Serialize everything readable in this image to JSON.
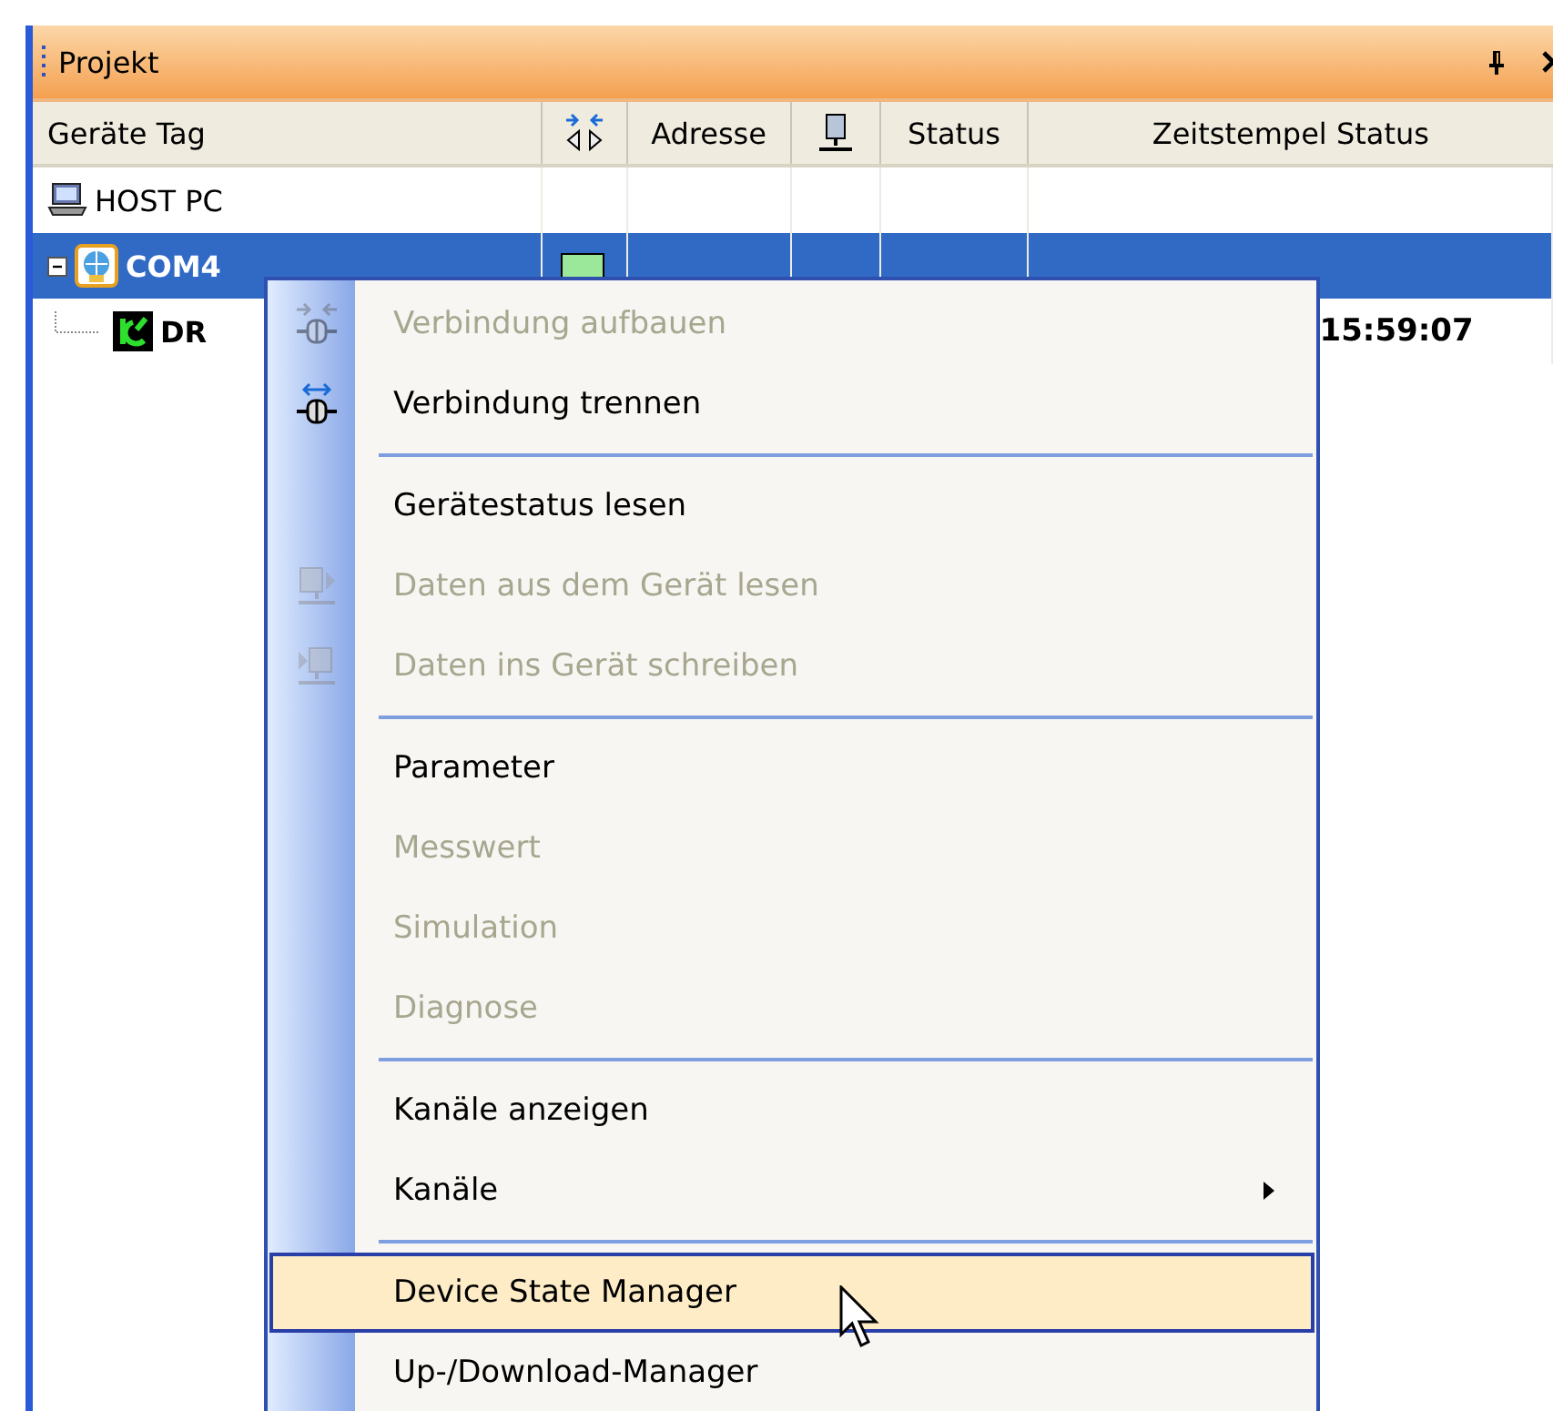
{
  "panel": {
    "title": "Projekt"
  },
  "table": {
    "columns": [
      {
        "kind": "text",
        "label": "Geräte Tag"
      },
      {
        "kind": "plug-icon"
      },
      {
        "kind": "text",
        "label": "Adresse"
      },
      {
        "kind": "device-icon"
      },
      {
        "kind": "text",
        "label": "Status"
      },
      {
        "kind": "text",
        "label": "Zeitstempel Status"
      }
    ],
    "rows": [
      {
        "kind": "pc",
        "name": "HOST PC",
        "selected": false
      },
      {
        "kind": "port",
        "name": "COM4",
        "selected": true,
        "expanded": true,
        "children": [
          {
            "kind": "device",
            "name": "DR",
            "selected": false,
            "timestamp": "15:59:07"
          }
        ]
      }
    ]
  },
  "context_menu": {
    "items": [
      {
        "kind": "plug-in",
        "label": "Verbindung aufbauen",
        "disabled": true,
        "selected": false
      },
      {
        "kind": "plug-out",
        "label": "Verbindung trennen",
        "disabled": false,
        "selected": false
      },
      {
        "kind": "separator"
      },
      {
        "kind": "item",
        "label": "Gerätestatus lesen",
        "disabled": false,
        "selected": false
      },
      {
        "kind": "device-read",
        "label": "Daten aus dem Gerät lesen",
        "disabled": true,
        "selected": false
      },
      {
        "kind": "device-write",
        "label": "Daten ins Gerät schreiben",
        "disabled": true,
        "selected": false
      },
      {
        "kind": "separator"
      },
      {
        "kind": "item",
        "label": "Parameter",
        "disabled": false,
        "selected": false
      },
      {
        "kind": "item",
        "label": "Messwert",
        "disabled": true,
        "selected": false
      },
      {
        "kind": "item",
        "label": "Simulation",
        "disabled": true,
        "selected": false
      },
      {
        "kind": "item",
        "label": "Diagnose",
        "disabled": true,
        "selected": false
      },
      {
        "kind": "separator"
      },
      {
        "kind": "item",
        "label": "Kanäle anzeigen",
        "disabled": false,
        "selected": false
      },
      {
        "kind": "submenu",
        "label": "Kanäle",
        "disabled": false,
        "selected": false
      },
      {
        "kind": "separator"
      },
      {
        "kind": "item",
        "label": "Device State Manager",
        "disabled": false,
        "selected": true
      },
      {
        "kind": "item",
        "label": "Up-/Download-Manager",
        "disabled": false,
        "selected": false
      }
    ]
  }
}
